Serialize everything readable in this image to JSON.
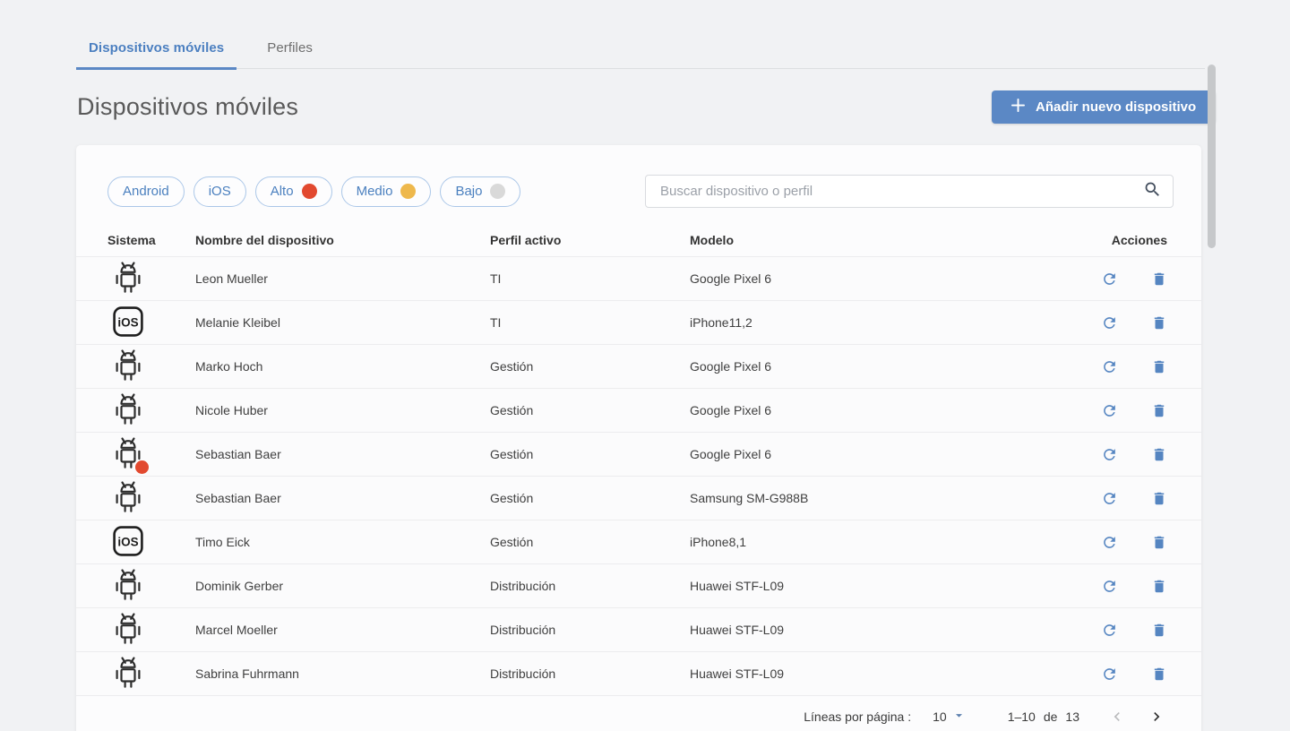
{
  "tabs": [
    {
      "label": "Dispositivos móviles",
      "active": true
    },
    {
      "label": "Perfiles",
      "active": false
    }
  ],
  "header": {
    "title": "Dispositivos móviles",
    "add_button_label": "Añadir nuevo dispositivo"
  },
  "filters": {
    "chips": [
      {
        "label": "Android",
        "dot": null
      },
      {
        "label": "iOS",
        "dot": null
      },
      {
        "label": "Alto",
        "dot": "#e2492f"
      },
      {
        "label": "Medio",
        "dot": "#eeb84c"
      },
      {
        "label": "Bajo",
        "dot": "#d9d9d9"
      }
    ],
    "search_placeholder": "Buscar dispositivo o perfil"
  },
  "table": {
    "columns": {
      "system": "Sistema",
      "name": "Nombre del dispositivo",
      "profile": "Perfil activo",
      "model": "Modelo",
      "actions": "Acciones"
    },
    "rows": [
      {
        "os": "android",
        "badge": false,
        "name": "Leon Mueller",
        "profile": "TI",
        "model": "Google Pixel 6"
      },
      {
        "os": "ios",
        "badge": false,
        "name": "Melanie Kleibel",
        "profile": "TI",
        "model": "iPhone11,2"
      },
      {
        "os": "android",
        "badge": false,
        "name": "Marko Hoch",
        "profile": "Gestión",
        "model": "Google Pixel 6"
      },
      {
        "os": "android",
        "badge": false,
        "name": "Nicole Huber",
        "profile": "Gestión",
        "model": "Google Pixel 6"
      },
      {
        "os": "android",
        "badge": true,
        "name": "Sebastian Baer",
        "profile": "Gestión",
        "model": "Google Pixel 6"
      },
      {
        "os": "android",
        "badge": false,
        "name": "Sebastian Baer",
        "profile": "Gestión",
        "model": "Samsung SM-G988B"
      },
      {
        "os": "ios",
        "badge": false,
        "name": "Timo Eick",
        "profile": "Gestión",
        "model": "iPhone8,1"
      },
      {
        "os": "android",
        "badge": false,
        "name": "Dominik Gerber",
        "profile": "Distribución",
        "model": "Huawei STF-L09"
      },
      {
        "os": "android",
        "badge": false,
        "name": "Marcel Moeller",
        "profile": "Distribución",
        "model": "Huawei STF-L09"
      },
      {
        "os": "android",
        "badge": false,
        "name": "Sabrina Fuhrmann",
        "profile": "Distribución",
        "model": "Huawei STF-L09"
      }
    ]
  },
  "pagination": {
    "rows_per_page_label": "Líneas por página :",
    "rows_per_page_value": "10",
    "range": "1–10",
    "of_label": "de",
    "total": "13"
  },
  "icons": {
    "ios_label": "iOS",
    "badge_color": "#e2492f"
  },
  "colors": {
    "accent_blue": "#5b88c5",
    "chip_blue": "#4b80bf",
    "alto_dot": "#e2492f",
    "medio_dot": "#eeb84c",
    "bajo_dot": "#d9d9d9"
  }
}
